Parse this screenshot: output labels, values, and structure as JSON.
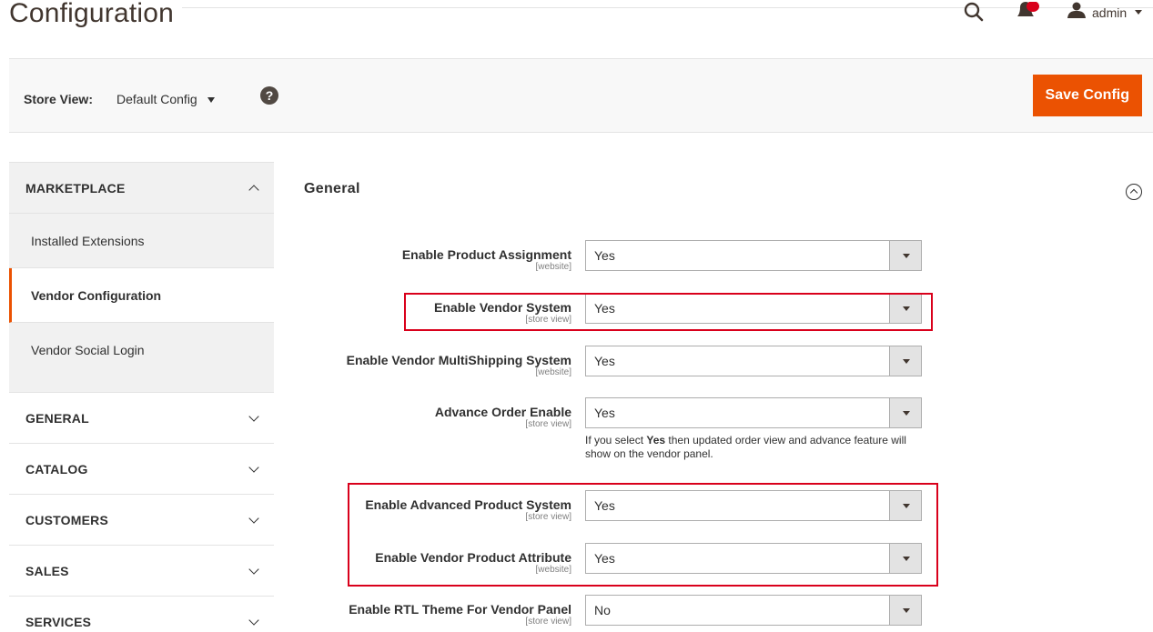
{
  "header": {
    "title": "Configuration",
    "user_label": "admin"
  },
  "store_bar": {
    "label": "Store View:",
    "value": "Default Config",
    "help": "?",
    "save_label": "Save Config"
  },
  "sidebar": {
    "marketplace": {
      "title": "MARKETPLACE",
      "items": [
        {
          "label": "Installed Extensions"
        },
        {
          "label": "Vendor Configuration"
        },
        {
          "label": "Vendor Social Login"
        }
      ]
    },
    "sections": [
      {
        "title": "GENERAL"
      },
      {
        "title": "CATALOG"
      },
      {
        "title": "CUSTOMERS"
      },
      {
        "title": "SALES"
      },
      {
        "title": "SERVICES"
      }
    ]
  },
  "main": {
    "section_title": "General",
    "fields": [
      {
        "label": "Enable Product Assignment",
        "scope": "[website]",
        "value": "Yes"
      },
      {
        "label": "Enable Vendor System",
        "scope": "[store view]",
        "value": "Yes"
      },
      {
        "label": "Enable Vendor MultiShipping System",
        "scope": "[website]",
        "value": "Yes"
      },
      {
        "label": "Advance Order Enable",
        "scope": "[store view]",
        "value": "Yes"
      },
      {
        "label": "Enable Advanced Product System",
        "scope": "[store view]",
        "value": "Yes"
      },
      {
        "label": "Enable Vendor Product Attribute",
        "scope": "[website]",
        "value": "Yes"
      },
      {
        "label": "Enable RTL Theme For Vendor Panel",
        "scope": "[store view]",
        "value": "No"
      }
    ],
    "note_prefix": "If you select ",
    "note_bold": "Yes",
    "note_suffix": " then updated order view and advance feature will show on the vendor panel."
  },
  "colors": {
    "accent": "#eb5202",
    "highlight": "#d9001b"
  }
}
